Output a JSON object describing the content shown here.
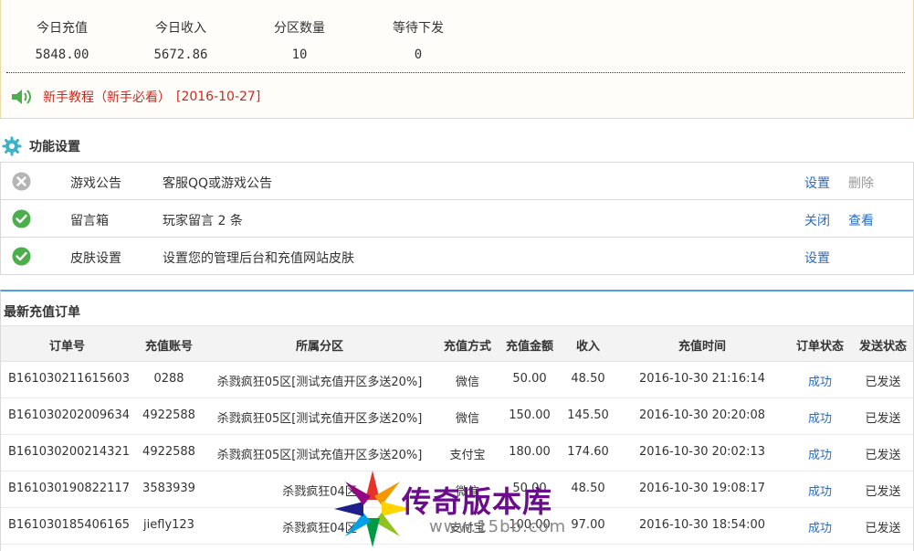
{
  "stats": {
    "items": [
      {
        "label": "今日充值",
        "value": "5848.00"
      },
      {
        "label": "今日收入",
        "value": "5672.86"
      },
      {
        "label": "分区数量",
        "value": "10"
      },
      {
        "label": "等待下发",
        "value": "0"
      }
    ]
  },
  "notice": {
    "text": "新手教程（新手必看）",
    "date": "[2016-10-27]",
    "icon": "speaker-icon"
  },
  "functions": {
    "title": "功能设置",
    "rows": [
      {
        "status": "disabled",
        "name": "游戏公告",
        "desc": "客服QQ或游戏公告",
        "action1": "设置",
        "action2": "删除"
      },
      {
        "status": "enabled",
        "name": "留言箱",
        "desc": "玩家留言 2 条",
        "action1": "关闭",
        "action2": "查看"
      },
      {
        "status": "enabled",
        "name": "皮肤设置",
        "desc": "设置您的管理后台和充值网站皮肤",
        "action1": "设置",
        "action2": ""
      }
    ]
  },
  "orders": {
    "title": "最新充值订单",
    "columns": [
      "订单号",
      "充值账号",
      "所属分区",
      "充值方式",
      "充值金额",
      "收入",
      "充值时间",
      "订单状态",
      "发送状态"
    ],
    "rows": [
      [
        "B161030211615603",
        "0288",
        "杀戮疯狂05区[测试充值开区多送20%]",
        "微信",
        "50.00",
        "48.50",
        "2016-10-30 21:16:14",
        "成功",
        "已发送"
      ],
      [
        "B161030202009634",
        "4922588",
        "杀戮疯狂05区[测试充值开区多送20%]",
        "微信",
        "150.00",
        "145.50",
        "2016-10-30 20:20:08",
        "成功",
        "已发送"
      ],
      [
        "B161030200214321",
        "4922588",
        "杀戮疯狂05区[测试充值开区多送20%]",
        "支付宝",
        "180.00",
        "174.60",
        "2016-10-30 20:02:13",
        "成功",
        "已发送"
      ],
      [
        "B161030190822117",
        "3583939",
        "杀戮疯狂04区",
        "微信",
        "50.00",
        "48.50",
        "2016-10-30 19:08:17",
        "成功",
        "已发送"
      ],
      [
        "B161030185406165",
        "jiefly123",
        "杀戮疯狂04区",
        "支付宝",
        "100.00",
        "97.00",
        "2016-10-30 18:54:00",
        "成功",
        "已发送"
      ]
    ]
  },
  "watermark": {
    "text": "传奇版本库",
    "url": "www.15bb.com"
  },
  "colors": {
    "accent": "#4aa3df",
    "link": "#2a6cc0",
    "notice": "#cc2a1f",
    "ok": "#4cae4c",
    "gear": "#3cb3c9"
  }
}
